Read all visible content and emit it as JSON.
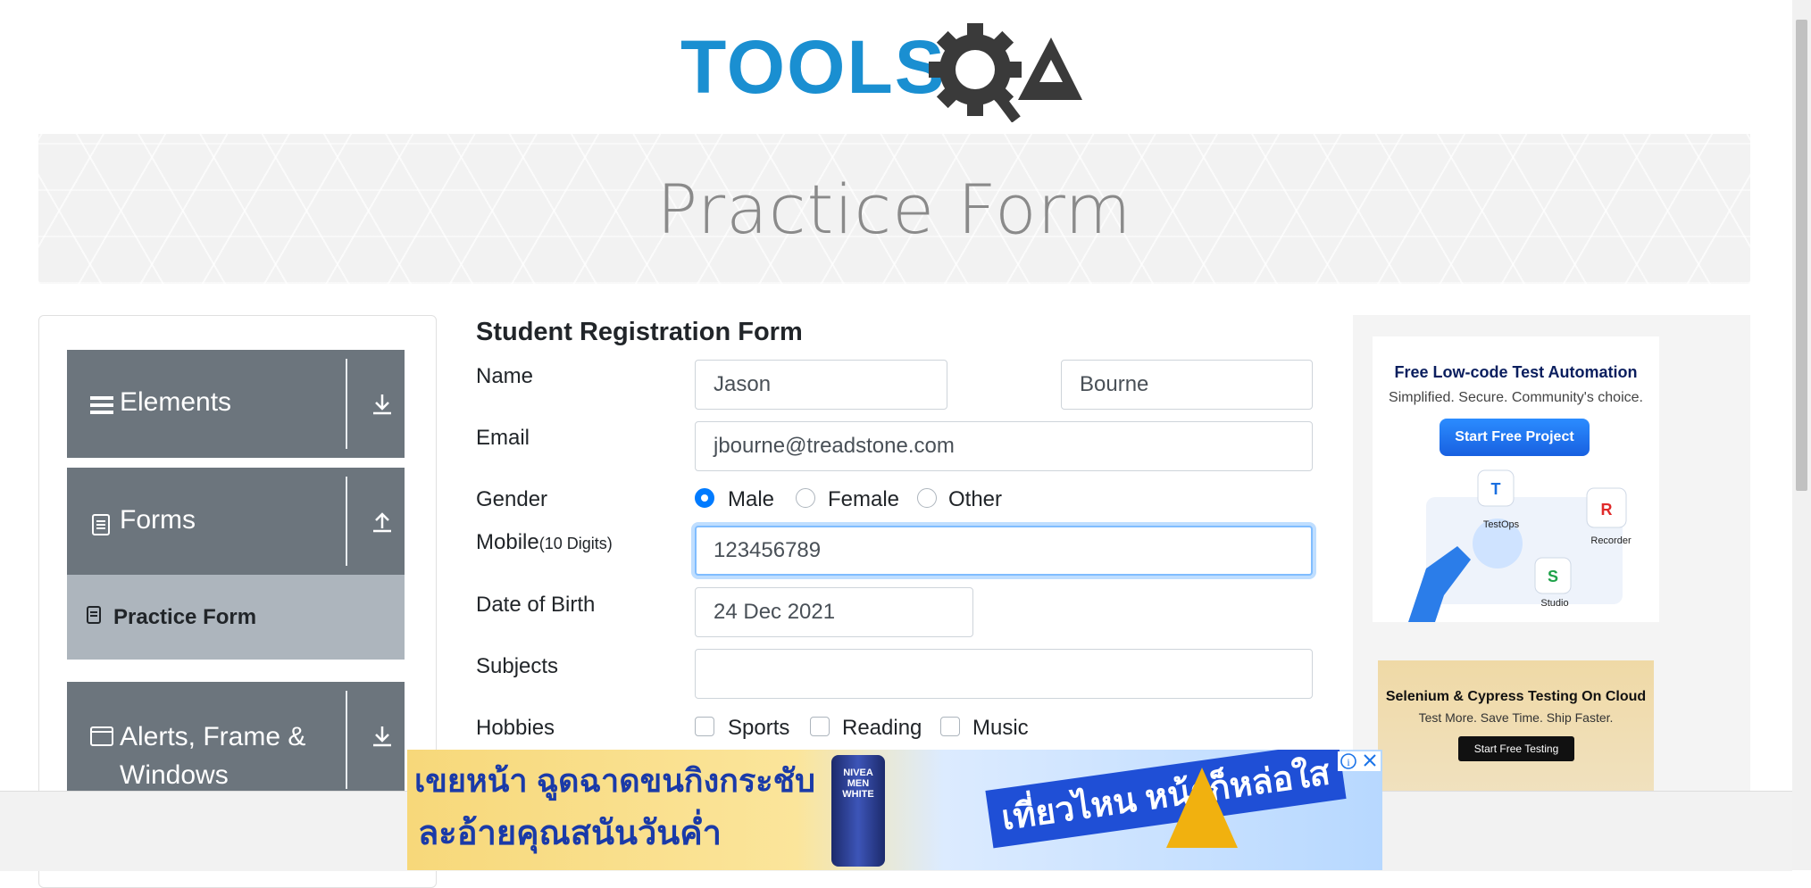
{
  "logo": {
    "text_left": "TOOLS",
    "text_right": "QA"
  },
  "banner": {
    "title": "Practice Form"
  },
  "sidebar": {
    "groups": [
      {
        "label": "Elements",
        "icon": "hamburger-icon",
        "arrow": "download-arrow-icon"
      },
      {
        "label": "Forms",
        "icon": "document-icon",
        "arrow": "upload-arrow-icon"
      },
      {
        "label_line1": "Alerts, Frame &",
        "label_line2": "Windows",
        "icon": "window-icon",
        "arrow": "download-arrow-icon"
      }
    ],
    "active_item": {
      "label": "Practice Form",
      "icon": "form-icon"
    }
  },
  "form": {
    "title": "Student Registration Form",
    "name_label": "Name",
    "first_name": "Jason",
    "last_name": "Bourne",
    "email_label": "Email",
    "email": "jbourne@treadstone.com",
    "gender_label": "Gender",
    "gender_options": [
      "Male",
      "Female",
      "Other"
    ],
    "gender_selected": "Male",
    "mobile_label": "Mobile",
    "mobile_hint": "(10 Digits)",
    "mobile": "123456789",
    "dob_label": "Date of Birth",
    "dob": "24 Dec 2021",
    "subjects_label": "Subjects",
    "subjects": "",
    "hobbies_label": "Hobbies",
    "hobbies": [
      "Sports",
      "Reading",
      "Music"
    ]
  },
  "right_ads": {
    "ad1": {
      "title": "Free Low-code Test Automation",
      "subtitle": "Simplified. Secure. Community's choice.",
      "button": "Start Free Project",
      "labels": [
        "TestOps",
        "Recorder",
        "Studio"
      ]
    },
    "ad2": {
      "title": "Selenium & Cypress Testing On Cloud",
      "subtitle": "Test More. Save Time. Ship Faster.",
      "button": "Start Free Testing"
    }
  },
  "bottom_ad": {
    "line1": "เขยหน้า ฉูดฉาดขนกิงกระชับ",
    "line2": "ละอ้ายคุณสนันวันค่ำ",
    "badge": "เที่ยวไหน หน้าก็หล่อใส",
    "product": "NIVEA MEN WHITE",
    "info_icon": "info-icon",
    "close_icon": "close-icon"
  }
}
